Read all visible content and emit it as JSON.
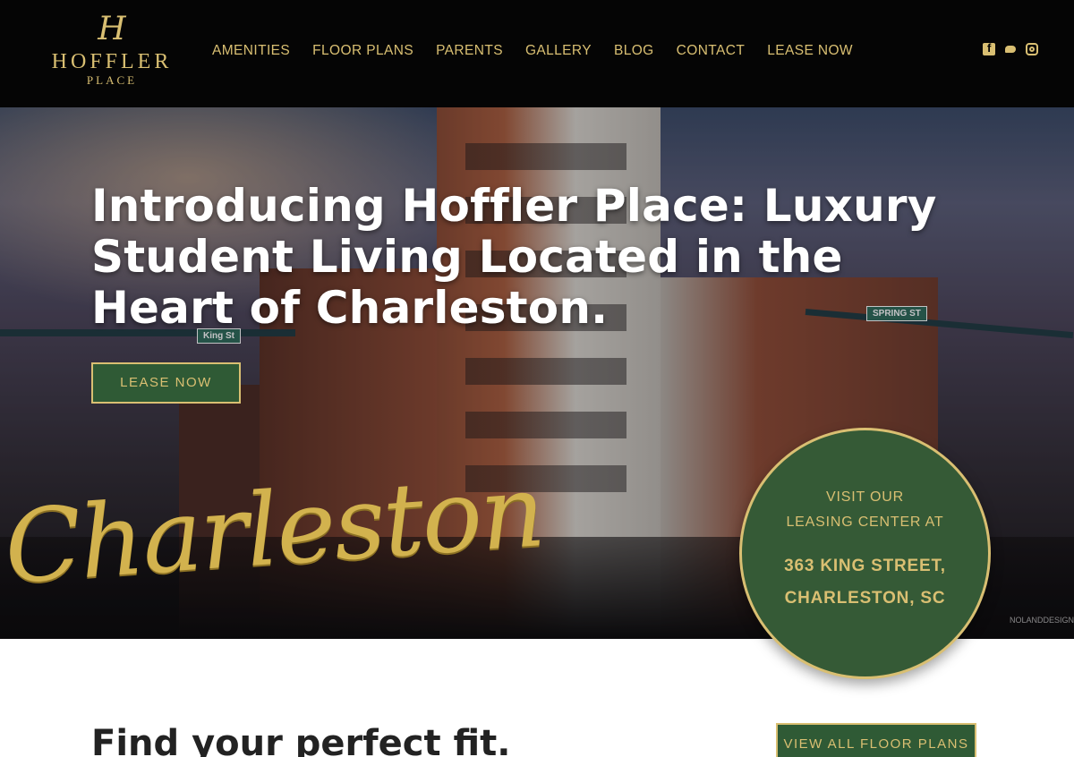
{
  "brand": {
    "logo_mark": "H",
    "logo_name": "HOFFLER",
    "logo_sub": "PLACE",
    "accent_gold": "#d9bf72",
    "accent_green": "#2f5a35"
  },
  "nav": {
    "items": [
      {
        "label": "AMENITIES"
      },
      {
        "label": "FLOOR PLANS"
      },
      {
        "label": "PARENTS"
      },
      {
        "label": "GALLERY"
      },
      {
        "label": "BLOG"
      },
      {
        "label": "CONTACT"
      },
      {
        "label": "LEASE NOW"
      }
    ]
  },
  "social": {
    "icons": [
      "facebook-icon",
      "twitter-icon",
      "instagram-icon"
    ]
  },
  "hero": {
    "title": "Introducing Hoffler Place: Luxury Student Living Located in the Heart of Charleston.",
    "cta_label": "LEASE NOW",
    "script_word": "Charleston",
    "street_sign_left": "King St",
    "street_sign_right": "SPRING ST",
    "credit": "NOLANDDESIGNSTUDIO.CO"
  },
  "leasing": {
    "line1": "VISIT OUR",
    "line2": "LEASING CENTER AT",
    "line3": "363 KING STREET,",
    "line4": "CHARLESTON, SC"
  },
  "section": {
    "heading": "Find your perfect fit.",
    "button_label": "VIEW ALL FLOOR PLANS"
  }
}
